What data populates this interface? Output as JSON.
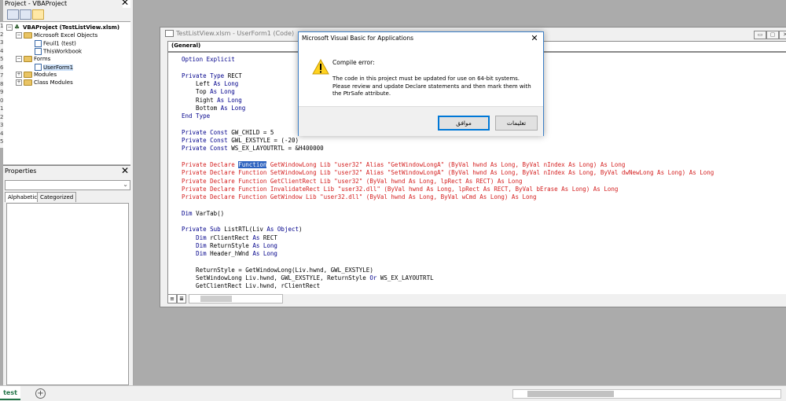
{
  "project_window": {
    "title": "Project - VBAProject",
    "close_label": "✕",
    "tree": [
      {
        "label": "VBAProject (TestListView.xlsm)",
        "expander": "−"
      },
      {
        "label": "Microsoft Excel Objects",
        "expander": "−"
      },
      {
        "label": "Feuil1 (test)"
      },
      {
        "label": "ThisWorkbook"
      },
      {
        "label": "Forms",
        "expander": "−"
      },
      {
        "label": "UserForm1"
      },
      {
        "label": "Modules",
        "expander": "+"
      },
      {
        "label": "Class Modules",
        "expander": "+"
      }
    ]
  },
  "excel": {
    "row_numbers": [
      "1",
      "2",
      "3",
      "4",
      "5",
      "6",
      "7",
      "8",
      "9",
      "0",
      "1",
      "2",
      "3",
      "4",
      "5"
    ],
    "sheet_tab": "test",
    "add_sheet": "+"
  },
  "properties_window": {
    "title": "Properties",
    "close_label": "✕",
    "dropdown_chevron": "⌄",
    "tabs": [
      "Alphabetic",
      "Categorized"
    ]
  },
  "code_window": {
    "title": "TestListView.xlsm - UserForm1 (Code)",
    "object_combo": "(General)",
    "win_buttons": [
      "▭",
      "▢",
      "✕"
    ],
    "view_buttons": [
      "≡",
      "≣"
    ],
    "lines": [
      {
        "parts": [
          {
            "t": "Option Explicit",
            "c": "kw"
          }
        ]
      },
      {
        "parts": []
      },
      {
        "parts": [
          {
            "t": "Private Type ",
            "c": "kw"
          },
          {
            "t": "RECT"
          }
        ]
      },
      {
        "parts": [
          {
            "t": "    Left "
          },
          {
            "t": "As Long",
            "c": "kw"
          }
        ]
      },
      {
        "parts": [
          {
            "t": "    Top "
          },
          {
            "t": "As Long",
            "c": "kw"
          }
        ]
      },
      {
        "parts": [
          {
            "t": "    Right "
          },
          {
            "t": "As Long",
            "c": "kw"
          }
        ]
      },
      {
        "parts": [
          {
            "t": "    Bottom "
          },
          {
            "t": "As Long",
            "c": "kw"
          }
        ]
      },
      {
        "parts": [
          {
            "t": "End Type",
            "c": "kw"
          }
        ]
      },
      {
        "parts": []
      },
      {
        "parts": [
          {
            "t": "Private Const ",
            "c": "kw"
          },
          {
            "t": "GW_CHILD = 5"
          }
        ]
      },
      {
        "parts": [
          {
            "t": "Private Const ",
            "c": "kw"
          },
          {
            "t": "GWL_EXSTYLE = (-20)"
          }
        ]
      },
      {
        "parts": [
          {
            "t": "Private Const ",
            "c": "kw"
          },
          {
            "t": "WS_EX_LAYOUTRTL = &H400000"
          }
        ]
      },
      {
        "parts": []
      },
      {
        "parts": [
          {
            "t": "Private Declare ",
            "c": "red"
          },
          {
            "t": "Function",
            "c": "hl"
          },
          {
            "t": " GetWindowLong Lib \"user32\" Alias \"GetWindowLongA\" (ByVal hwnd As Long, ByVal nIndex As Long) As Long",
            "c": "red"
          }
        ]
      },
      {
        "parts": [
          {
            "t": "Private Declare Function SetWindowLong Lib \"user32\" Alias \"SetWindowLongA\" (ByVal hwnd As Long, ByVal nIndex As Long, ByVal dwNewLong As Long) As Long",
            "c": "red"
          }
        ]
      },
      {
        "parts": [
          {
            "t": "Private Declare Function GetClientRect Lib \"user32\" (ByVal hwnd As Long, lpRect As RECT) As Long",
            "c": "red"
          }
        ]
      },
      {
        "parts": [
          {
            "t": "Private Declare Function InvalidateRect Lib \"user32.dll\" (ByVal hwnd As Long, lpRect As RECT, ByVal bErase As Long) As Long",
            "c": "red"
          }
        ]
      },
      {
        "parts": [
          {
            "t": "Private Declare Function GetWindow Lib \"user32.dll\" (ByVal hwnd As Long, ByVal wCmd As Long) As Long",
            "c": "red"
          }
        ]
      },
      {
        "parts": []
      },
      {
        "parts": [
          {
            "t": "Dim ",
            "c": "kw"
          },
          {
            "t": "VarTab()"
          }
        ]
      },
      {
        "parts": []
      },
      {
        "parts": [
          {
            "t": "Private Sub ",
            "c": "kw"
          },
          {
            "t": "ListRTL(Liv "
          },
          {
            "t": "As Object",
            "c": "kw"
          },
          {
            "t": ")"
          }
        ]
      },
      {
        "parts": [
          {
            "t": "    "
          },
          {
            "t": "Dim ",
            "c": "kw"
          },
          {
            "t": "rClientRect "
          },
          {
            "t": "As ",
            "c": "kw"
          },
          {
            "t": "RECT"
          }
        ]
      },
      {
        "parts": [
          {
            "t": "    "
          },
          {
            "t": "Dim ",
            "c": "kw"
          },
          {
            "t": "ReturnStyle "
          },
          {
            "t": "As Long",
            "c": "kw"
          }
        ]
      },
      {
        "parts": [
          {
            "t": "    "
          },
          {
            "t": "Dim ",
            "c": "kw"
          },
          {
            "t": "Header_hWnd "
          },
          {
            "t": "As Long",
            "c": "kw"
          }
        ]
      },
      {
        "parts": []
      },
      {
        "parts": [
          {
            "t": "    ReturnStyle = GetWindowLong(Liv.hwnd, GWL_EXSTYLE)"
          }
        ]
      },
      {
        "parts": [
          {
            "t": "    SetWindowLong Liv.hwnd, GWL_EXSTYLE, ReturnStyle "
          },
          {
            "t": "Or ",
            "c": "kw"
          },
          {
            "t": "WS_EX_LAYOUTRTL"
          }
        ]
      },
      {
        "parts": [
          {
            "t": "    GetClientRect Liv.hwnd, rClientRect"
          }
        ]
      }
    ]
  },
  "dialog": {
    "title": "Microsoft Visual Basic for Applications",
    "close_label": "✕",
    "heading": "Compile error:",
    "message": "The code in this project must be updated for use on 64-bit systems. Please review and update Declare statements and then mark them with the PtrSafe attribute.",
    "ok_label": "موافق",
    "help_label": "تعليمات"
  }
}
